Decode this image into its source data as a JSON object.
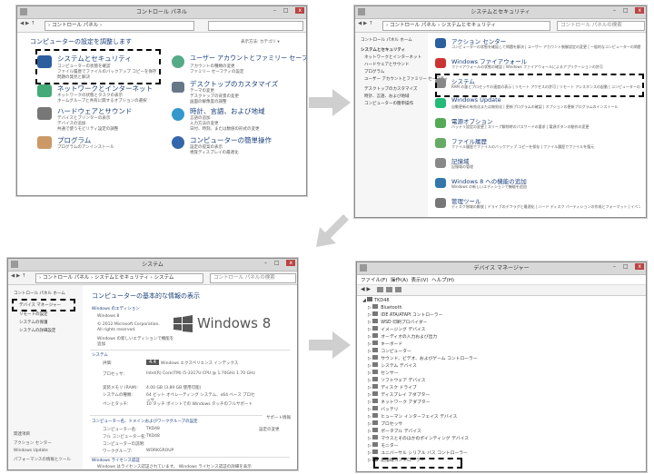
{
  "p1": {
    "title": "コントロール パネル",
    "addr": "› コントロール パネル ›",
    "heading": "コンピューターの設定を調整します",
    "view": "表示方法: カテゴリ ▾",
    "cats": [
      {
        "t": "システムとセキュリティ",
        "l": [
          "コンピューターの状態を確認",
          "ファイル履歴でファイルのバックアップ コピーを保存",
          "問題の発見と解決"
        ]
      },
      {
        "t": "ネットワークとインターネット",
        "l": [
          "ネットワークの状態とタスクの表示",
          "ホームグループと共有に関するオプションの選択"
        ]
      },
      {
        "t": "ハードウェアとサウンド",
        "l": [
          "デバイスとプリンターの表示",
          "デバイスの追加",
          "共通で使うモビリティ設定の調整"
        ]
      },
      {
        "t": "プログラム",
        "l": [
          "プログラムのアンインストール"
        ]
      },
      {
        "t": "ユーザー アカウントとファミリー セーフティ",
        "l": [
          "アカウントの種類の変更",
          "ファミリー セーフティの設定"
        ]
      },
      {
        "t": "デスクトップのカスタマイズ",
        "l": [
          "テーマの変更",
          "デスクトップの背景の変更",
          "画面の解像度の調整"
        ]
      },
      {
        "t": "時計、言語、および地域",
        "l": [
          "言語の追加",
          "入力方法の変更",
          "日付、時刻、または数値の形式の変更"
        ]
      },
      {
        "t": "コンピューターの簡単操作",
        "l": [
          "設定の提案の表示",
          "視覚ディスプレイの最適化"
        ]
      }
    ]
  },
  "p2": {
    "title": "システムとセキュリティ",
    "addr": "› コントロール パネル › システムとセキュリティ",
    "search": "コントロール パネルの検索",
    "side": [
      "コントロール パネル ホーム",
      "システムとセキュリティ",
      "ネットワークとインターネット",
      "ハードウェアとサウンド",
      "プログラム",
      "ユーザー アカウントとファミリー セーフティ",
      "デスクトップのカスタマイズ",
      "時計、言語、および地域",
      "コンピューターの簡単操作"
    ],
    "items": [
      {
        "t": "アクション センター",
        "l": "コンピューターの状態を確認して問題を解決 | ユーザー アカウント制御設定の変更 | 一般的なコンピューターの問題のトラブルシューティング"
      },
      {
        "t": "Windows ファイアウォール",
        "l": "ファイアウォールの状態の確認 | Windows ファイアウォールによるアプリケーションの許可"
      },
      {
        "t": "システム",
        "l": "RAM の量とプロセッサの速度の表示 | リモート アクセスの許可 | リモート アシスタンスの起動 | コンピューターの名前の参照 | デバイス マネージャー"
      },
      {
        "t": "Windows Update",
        "l": "自動更新の有効化または無効化 | 更新プログラムの確認 | オプションの更新プログラムのインストール"
      },
      {
        "t": "電源オプション",
        "l": "バッテリ設定の変更 | スリープ解除時のパスワードの要求 | 電源ボタンの動作の変更"
      },
      {
        "t": "ファイル履歴",
        "l": "ファイル履歴でファイルのバックアップ コピーを保存 | ファイル履歴でファイルを復元"
      },
      {
        "t": "記憶域",
        "l": "記憶域の管理"
      },
      {
        "t": "Windows 8 への機能の追加",
        "l": "Windows の新しいエディションで機能を追加"
      },
      {
        "t": "管理ツール",
        "l": "ディスク領域の解放 | ドライブのデフラグと最適化 | ハード ディスク パーティションの作成とフォーマット | イベント ログの表示 | タスクのスケジュール"
      }
    ]
  },
  "p3": {
    "title": "システム",
    "addr": "› コントロール パネル › システムとセキュリティ › システム",
    "search": "コントロール パネルの検索",
    "side": [
      "コントロール パネル ホーム",
      "デバイス マネージャー",
      "リモートの設定",
      "システムの保護",
      "システムの詳細設定"
    ],
    "see": [
      "関連項目",
      "アクション センター",
      "Windows Update",
      "パフォーマンスの情報とツール"
    ],
    "heading": "コンピューターの基本的な情報の表示",
    "ed_h": "Windows のエディション",
    "ed": [
      "Windows 8",
      "© 2012 Microsoft Corporation.",
      "All rights reserved.",
      "Windows の新しいエディションで機能を",
      "追加"
    ],
    "logo": "Windows 8",
    "sys_h": "システム",
    "sys": [
      [
        "評価:",
        "Windows エクスペリエンス インデックス"
      ],
      [
        "プロセッサ:",
        "Intel(R) Core(TM) i5-3317U CPU @ 1.70GHz 1.70 GHz"
      ],
      [
        "実装メモリ (RAM):",
        "4.00 GB (3.89 GB 使用可能)"
      ],
      [
        "システムの種類:",
        "64 ビット オペレーティング システム、x64 ベース プロセッサ"
      ],
      [
        "ペンとタッチ:",
        "10 タッチ ポイントでの Windows タッチのフルサポート"
      ]
    ],
    "score": "4.4",
    "support": "サポート情報",
    "nm_h": "コンピューター名、ドメインおよびワークグループの設定",
    "nm": [
      [
        "コンピューター名:",
        "TKD48"
      ],
      [
        "フル コンピューター名:",
        "TKD48"
      ],
      [
        "コンピューターの説明:",
        ""
      ],
      [
        "ワークグループ:",
        "WORKGROUP"
      ]
    ],
    "change": "設定の変更",
    "lic_h": "Windows ライセンス認証",
    "lic": "Windows はライセンス認証されています。 Windows ライセンス認証の詳細を表示"
  },
  "p4": {
    "title": "デバイス マネージャー",
    "menu": [
      "ファイル(F)",
      "操作(A)",
      "表示(V)",
      "ヘルプ(H)"
    ],
    "root": "TKD48",
    "nodes": [
      "Bluetooth",
      "IDE ATA/ATAPI コントローラー",
      "WSD 印刷プロバイダー",
      "イメージング デバイス",
      "オーディオの入力および出力",
      "キーボード",
      "コンピューター",
      "サウンド、ビデオ、およびゲーム コントローラー",
      "システム デバイス",
      "センサー",
      "ソフトウェア デバイス",
      "ディスク ドライブ",
      "ディスプレイ アダプター",
      "ネットワーク アダプター",
      "バッテリ",
      "ヒューマン インターフェイス デバイス",
      "プロセッサ",
      "ポータブル デバイス",
      "マウスとそのほかのポインティング デバイス",
      "モニター",
      "ユニバーサル シリアル バス コントローラー",
      "記憶域コントローラー"
    ]
  }
}
